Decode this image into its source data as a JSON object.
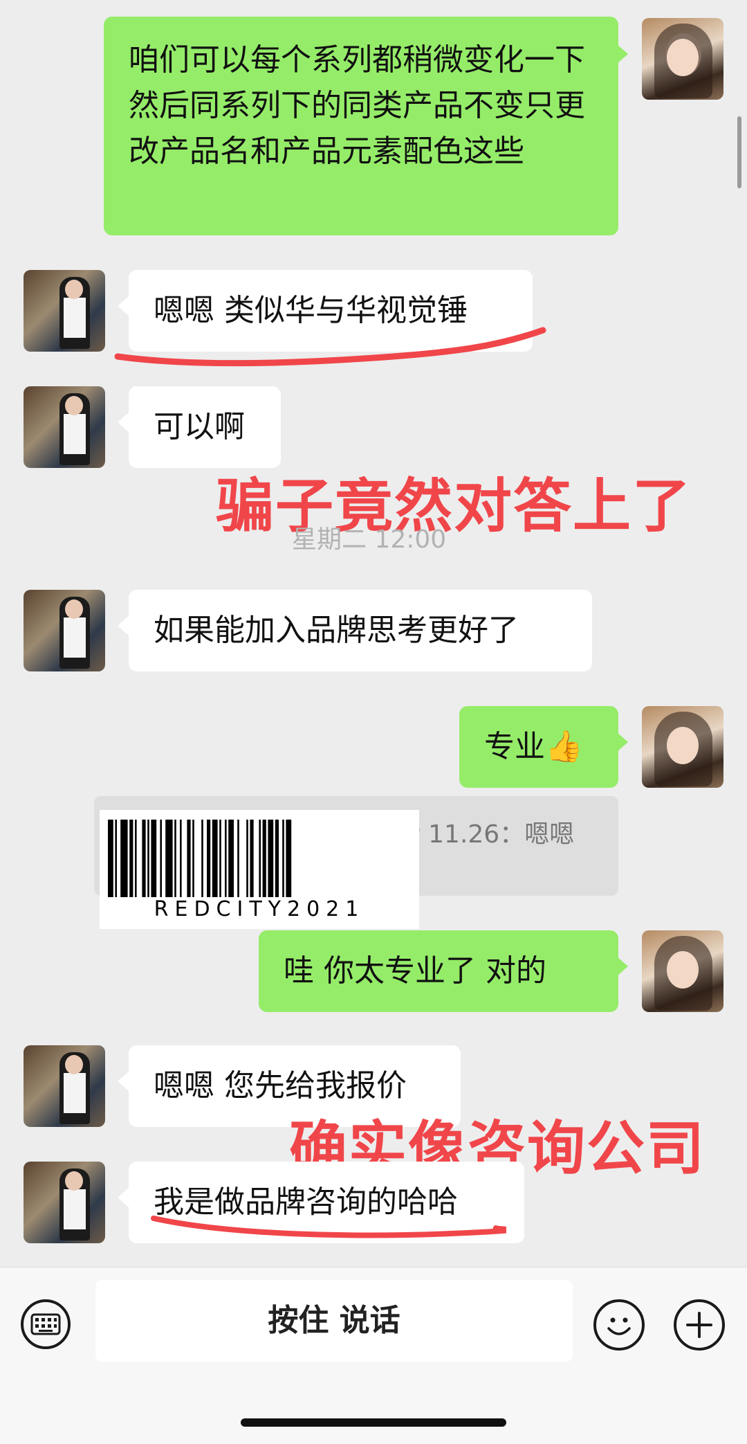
{
  "messages": [
    {
      "side": "right",
      "text": "咱们可以每个系列都稍微变化一下  然后同系列下的同类产品不变只更改产品名和产品元素配色这些"
    },
    {
      "side": "left",
      "text": "嗯嗯 类似华与华视觉锤"
    },
    {
      "side": "left",
      "text": "可以啊"
    },
    {
      "side": "left",
      "text": "如果能加入品牌思考更好了"
    },
    {
      "side": "right",
      "text": "专业👍"
    },
    {
      "side": "right",
      "text": "哇 你太专业了  对的"
    },
    {
      "side": "left",
      "text": "嗯嗯 您先给我报价"
    },
    {
      "side": "left",
      "text": "我是做品牌咨询的哈哈"
    }
  ],
  "timestamp": "星期二 12:00",
  "quote_text": "P 11.26：嗯嗯",
  "overlay_captions": [
    "骗子竟然对答上了",
    "确实像咨询公司"
  ],
  "watermark_text": "REDCITY2021",
  "input_bar": {
    "hold_to_talk_label": "按住 说话"
  },
  "icons": {
    "keyboard": "keyboard-icon",
    "emoji": "emoji-icon",
    "plus": "plus-icon"
  },
  "colors": {
    "green_bubble": "#95ec69",
    "white_bubble": "#ffffff",
    "background": "#ededed",
    "annotation_red": "#f0464a"
  }
}
